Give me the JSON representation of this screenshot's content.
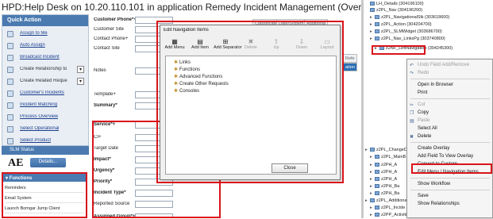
{
  "title": "HPD:Help Desk on 10.20.110.101 in application Remedy Incident Management (Overlay)",
  "quick_action": {
    "header": "Quick Action",
    "items": [
      {
        "label": "Assign to Me",
        "link": true
      },
      {
        "label": "Auto Assign",
        "link": true
      },
      {
        "label": "Broadcast Incident",
        "link": true
      },
      {
        "label": "Create Relationship to",
        "link": false
      },
      {
        "label": "Create Related Reque",
        "link": false
      },
      {
        "label": "Customer's Incidents",
        "link": true
      },
      {
        "label": "Incident Matching",
        "link": true
      },
      {
        "label": "Process Overview",
        "link": true
      },
      {
        "label": "Select Operational",
        "link": true
      },
      {
        "label": "Select Product",
        "link": true
      }
    ]
  },
  "slm_status": "SLM Status",
  "ae_label": "AE",
  "details_button": "Details...",
  "functions": {
    "header": "Functions",
    "items": [
      "Reminders",
      "Email System",
      "Launch Bomgar Jump Client"
    ]
  },
  "form": {
    "fields": [
      {
        "label": "Customer Phone*+",
        "bold": true
      },
      {
        "label": "Customer Site",
        "bold": false
      },
      {
        "label": "Contact Phone+",
        "bold": false
      },
      {
        "label": "Contact Site",
        "bold": false
      },
      {
        "label": "Notes",
        "bold": false
      },
      {
        "label": "Template+",
        "bold": false
      },
      {
        "label": "Summary*",
        "bold": true
      },
      {
        "label": "Service*+",
        "bold": true
      },
      {
        "label": "CI+",
        "bold": false
      },
      {
        "label": "Target Date",
        "bold": false
      },
      {
        "label": "Impact*",
        "bold": true
      },
      {
        "label": "Urgency*",
        "bold": true
      },
      {
        "label": "Priority*",
        "bold": true
      },
      {
        "label": "Incident Type*",
        "bold": true
      },
      {
        "label": "Reported Source",
        "bold": false
      },
      {
        "label": "Assigned Group*+",
        "bold": true
      },
      {
        "label": "Assignee+",
        "bold": false
      }
    ],
    "tabs": [
      "Classification",
      "Date/System",
      "Additional"
    ],
    "tab_partial": [
      "Refe",
      "ation"
    ]
  },
  "dialog": {
    "title": "Edit Navigation Items",
    "toolbar": [
      {
        "label": "Add Menu",
        "icon": "add-menu-icon",
        "enabled": true
      },
      {
        "label": "Add Item",
        "icon": "add-item-icon",
        "enabled": true
      },
      {
        "label": "Add Separator",
        "icon": "add-separator-icon",
        "enabled": true
      },
      {
        "label": "Delete",
        "icon": "delete-icon",
        "enabled": false
      },
      {
        "label": "Up",
        "icon": "up-icon",
        "enabled": false
      },
      {
        "label": "Down",
        "icon": "down-icon",
        "enabled": false
      },
      {
        "label": "Layout",
        "icon": "layout-icon",
        "enabled": false
      }
    ],
    "items": [
      "Links",
      "Functions",
      "Advanced Functions",
      "Create Other Requests",
      "Consoles"
    ],
    "close_label": "Close"
  },
  "tree": [
    {
      "label": "LH_Details (304196100)",
      "indent": 0
    },
    {
      "label": "z2PL_Nav (304196200)",
      "indent": 0
    },
    {
      "label": "z2PL_NavigationalSlk (303618600)",
      "indent": 1
    },
    {
      "label": "z2PL_Action (304204700)",
      "indent": 1
    },
    {
      "label": "z2PL_SLMWidget (303686700)",
      "indent": 1
    },
    {
      "label": "z2PL_Nav_LinksPg (303740800)",
      "indent": 1
    },
    {
      "label": "z2NF_LeftNavigation (304245300)",
      "indent": 2
    },
    {
      "label": "z2PL_ChangeDo",
      "indent": 0
    },
    {
      "label": "z2PL_MainB",
      "indent": 1
    },
    {
      "label": "z2PH_A",
      "indent": 1
    },
    {
      "label": "z2PH_A",
      "indent": 1
    },
    {
      "label": "z2PH_A",
      "indent": 1
    },
    {
      "label": "z2PH_Ba",
      "indent": 1
    },
    {
      "label": "z2PH_Ba",
      "indent": 1
    },
    {
      "label": "z2PL_Additiona",
      "indent": 0
    },
    {
      "label": "z2PL_Incide",
      "indent": 1
    },
    {
      "label": "z2PP_Activities (301626100)",
      "indent": 1
    }
  ],
  "context_menu": [
    {
      "label": "Undo Field Add/Remove",
      "enabled": false,
      "icon": "undo-icon"
    },
    {
      "label": "Redo",
      "enabled": false,
      "icon": "redo-icon"
    },
    {
      "sep": true
    },
    {
      "label": "Open In Browser",
      "enabled": true
    },
    {
      "label": "Print",
      "enabled": true
    },
    {
      "sep": true
    },
    {
      "label": "Cut",
      "enabled": false,
      "icon": "cut-icon"
    },
    {
      "label": "Copy",
      "enabled": true,
      "icon": "copy-icon"
    },
    {
      "label": "Paste",
      "enabled": false,
      "icon": "paste-icon"
    },
    {
      "label": "Select All",
      "enabled": true
    },
    {
      "label": "Delete",
      "enabled": true,
      "icon": "delete-icon"
    },
    {
      "sep": true
    },
    {
      "label": "Create Overlay",
      "enabled": true
    },
    {
      "label": "Add Field To View Overlay",
      "enabled": true
    },
    {
      "label": "Convert to Custom",
      "enabled": true
    },
    {
      "label": "Edit Menu / Navigation Items...",
      "enabled": true
    },
    {
      "sep": true
    },
    {
      "label": "Show Workflow",
      "enabled": true
    },
    {
      "sep": true
    },
    {
      "label": "Save",
      "enabled": true
    },
    {
      "label": "Show Relationships",
      "enabled": true
    }
  ],
  "colors": {
    "accent": "#4a7ab0",
    "highlight_border": "#d9141b"
  }
}
